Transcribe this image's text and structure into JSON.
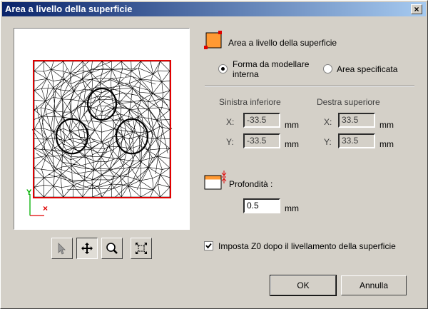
{
  "window": {
    "title": "Area a livello della superficie",
    "close_label": "×"
  },
  "options": {
    "header_label": "Area a livello della superficie",
    "radio_internal_line1": "Forma da modellare",
    "radio_internal_line2": "interna",
    "radio_internal_checked": true,
    "radio_specified": "Area specificata",
    "radio_specified_checked": false
  },
  "bounds": {
    "lower_left": {
      "title": "Sinistra inferiore",
      "x_label": "X:",
      "x_value": "-33.5",
      "y_label": "Y:",
      "y_value": "-33.5",
      "unit": "mm"
    },
    "upper_right": {
      "title": "Destra superiore",
      "x_label": "X:",
      "x_value": "33.5",
      "y_label": "Y:",
      "y_value": "33.5",
      "unit": "mm"
    }
  },
  "depth": {
    "label": "Profondità :",
    "value": "0.5",
    "unit": "mm"
  },
  "set_z0": {
    "label": "Imposta Z0 dopo il livellamento della superficie",
    "checked": true
  },
  "preview": {
    "axis_y": "Y",
    "axis_x": "×",
    "outline_color": "#e00000",
    "mesh_color": "#000000"
  },
  "toolbar": [
    "select-tool",
    "pan-tool",
    "zoom-tool",
    "fit-view-tool"
  ],
  "buttons": {
    "ok": "OK",
    "cancel": "Annulla"
  }
}
